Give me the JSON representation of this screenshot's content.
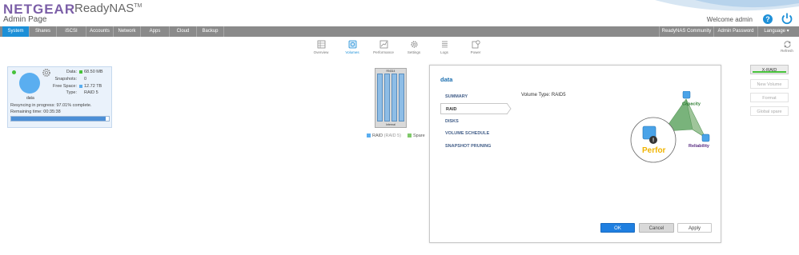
{
  "header": {
    "brand": "NETGEAR",
    "product": "ReadyNAS",
    "product_mark": "TM",
    "subtitle": "Admin Page",
    "welcome": "Welcome admin",
    "help_glyph": "?"
  },
  "nav": {
    "items": [
      "System",
      "Shares",
      "iSCSI",
      "Accounts",
      "Network",
      "Apps",
      "Cloud",
      "Backup"
    ],
    "right_items": [
      "ReadyNAS Community",
      "Admin Password",
      "Language ▾"
    ],
    "active": "System"
  },
  "subnav": {
    "items": [
      {
        "label": "Overview",
        "icon": "overview-icon"
      },
      {
        "label": "Volumes",
        "icon": "volumes-icon"
      },
      {
        "label": "Performance",
        "icon": "performance-icon"
      },
      {
        "label": "Settings",
        "icon": "settings-icon"
      },
      {
        "label": "Logs",
        "icon": "logs-icon"
      },
      {
        "label": "Power",
        "icon": "power-icon"
      }
    ],
    "active": "Volumes",
    "refresh_label": "Refresh"
  },
  "volume_card": {
    "name": "data",
    "data_label": "Data:",
    "data_value": "68.50 MB",
    "snapshots_label": "Snapshots:",
    "snapshots_value": "0",
    "free_label": "Free Space:",
    "free_value": "12.72 TB",
    "type_label": "Type:",
    "type_value": "RAID 5",
    "resync_text": "Resyncing in progress: 97.01% complete.",
    "remaining_text": "Remaining time: 00:35:38",
    "progress_fraction": 0.9701,
    "colors": {
      "data": "#46c23a",
      "free": "#5aaef0",
      "status_dot": "#46c23a"
    }
  },
  "enclosure": {
    "model": "RN314",
    "bottom_label": "Internal",
    "bay_count": 4,
    "legend": [
      {
        "label": "RAID",
        "detail": "(RAID 5)",
        "color": "#5aaef0"
      },
      {
        "label": "Spare",
        "detail": "",
        "color": "#7fc96a"
      }
    ]
  },
  "dialog": {
    "title": "data",
    "tabs": [
      "SUMMARY",
      "RAID",
      "DISKS",
      "VOLUME SCHEDULE",
      "SNAPSHOT PRUNING"
    ],
    "active_tab": "RAID",
    "volume_type_label": "Volume Type: RAID5",
    "diagram": {
      "capacity_label": "Capacity",
      "reliability_label": "Reliability",
      "performance_label": "Perfor"
    },
    "buttons": {
      "ok": "OK",
      "cancel": "Cancel",
      "apply": "Apply"
    }
  },
  "side_actions": {
    "xraid": "X-RAID",
    "new_volume": "New Volume",
    "format": "Format",
    "global_spare": "Global spare"
  }
}
